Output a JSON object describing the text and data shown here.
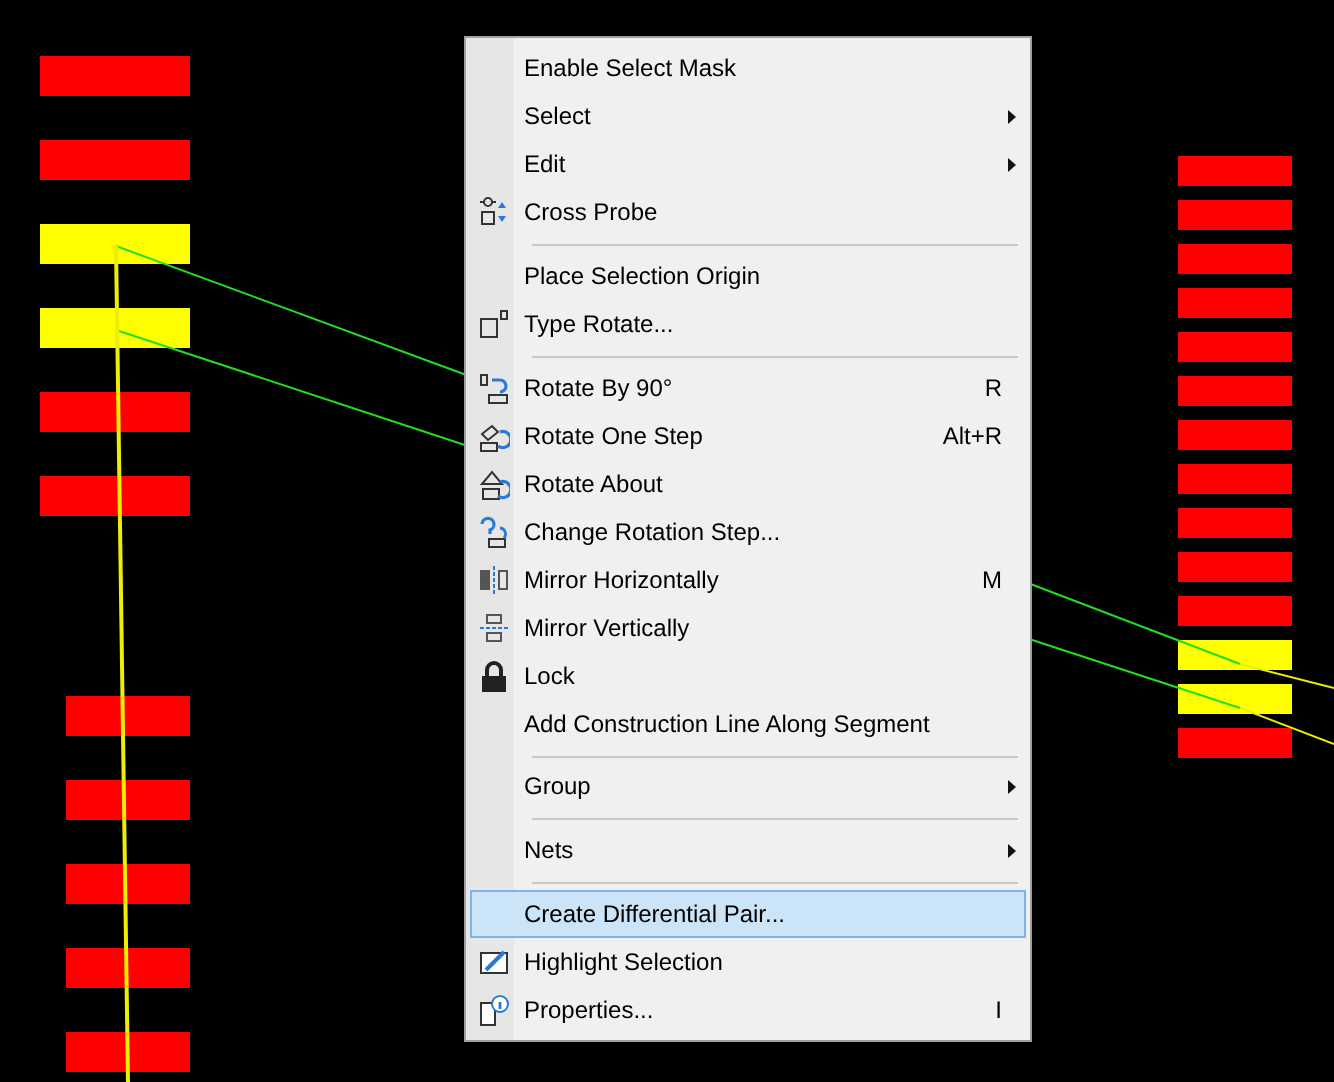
{
  "pcb": {
    "left_pads_upper": [
      {
        "selected": false
      },
      {
        "selected": false
      },
      {
        "selected": true
      },
      {
        "selected": true
      },
      {
        "selected": false
      },
      {
        "selected": false
      }
    ],
    "left_pads_lower": [
      {
        "selected": false
      },
      {
        "selected": false
      },
      {
        "selected": false
      },
      {
        "selected": false
      },
      {
        "selected": false
      }
    ],
    "right_pads": [
      {
        "selected": false
      },
      {
        "selected": false
      },
      {
        "selected": false
      },
      {
        "selected": false
      },
      {
        "selected": false
      },
      {
        "selected": false
      },
      {
        "selected": false
      },
      {
        "selected": false
      },
      {
        "selected": false
      },
      {
        "selected": false
      },
      {
        "selected": false
      },
      {
        "selected": true
      },
      {
        "selected": true
      },
      {
        "selected": false
      }
    ]
  },
  "context_menu": {
    "items": [
      {
        "kind": "item",
        "label": "Enable Select Mask",
        "submenu": false,
        "selected": false
      },
      {
        "kind": "item",
        "label": "Select",
        "submenu": true,
        "selected": false
      },
      {
        "kind": "item",
        "label": "Edit",
        "submenu": true,
        "selected": false
      },
      {
        "kind": "item",
        "label": "Cross Probe",
        "submenu": false,
        "selected": false
      },
      {
        "kind": "separator"
      },
      {
        "kind": "item",
        "label": "Place Selection Origin",
        "submenu": false,
        "selected": false
      },
      {
        "kind": "item",
        "label": "Type Rotate...",
        "submenu": false,
        "selected": false
      },
      {
        "kind": "separator"
      },
      {
        "kind": "item",
        "label": "Rotate By 90°",
        "shortcut": "R",
        "submenu": false,
        "selected": false
      },
      {
        "kind": "item",
        "label": "Rotate One Step",
        "shortcut": "Alt+R",
        "submenu": false,
        "selected": false
      },
      {
        "kind": "item",
        "label": "Rotate About",
        "submenu": false,
        "selected": false
      },
      {
        "kind": "item",
        "label": "Change Rotation Step...",
        "submenu": false,
        "selected": false
      },
      {
        "kind": "item",
        "label": "Mirror Horizontally",
        "shortcut": "M",
        "submenu": false,
        "selected": false
      },
      {
        "kind": "item",
        "label": "Mirror Vertically",
        "submenu": false,
        "selected": false
      },
      {
        "kind": "item",
        "label": "Lock",
        "submenu": false,
        "selected": false
      },
      {
        "kind": "item",
        "label": "Add Construction Line Along Segment",
        "submenu": false,
        "selected": false
      },
      {
        "kind": "separator"
      },
      {
        "kind": "item",
        "label": "Group",
        "submenu": true,
        "selected": false
      },
      {
        "kind": "separator"
      },
      {
        "kind": "item",
        "label": "Nets",
        "submenu": true,
        "selected": false
      },
      {
        "kind": "separator"
      },
      {
        "kind": "item",
        "label": "Create Differential Pair...",
        "submenu": false,
        "selected": true
      },
      {
        "kind": "item",
        "label": "Highlight Selection",
        "submenu": false,
        "selected": false
      },
      {
        "kind": "item",
        "label": "Properties...",
        "shortcut": "I",
        "submenu": false,
        "selected": false
      }
    ]
  }
}
